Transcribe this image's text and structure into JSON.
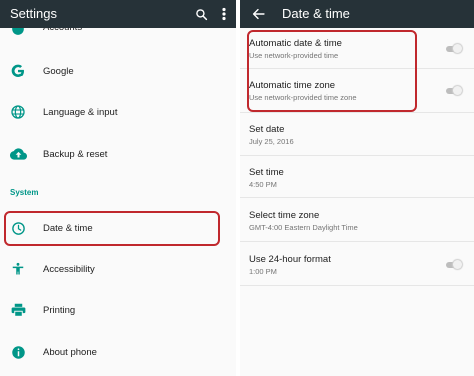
{
  "left": {
    "title": "Settings",
    "partial_item": "Accounts",
    "items": [
      {
        "label": "Google"
      },
      {
        "label": "Language & input"
      },
      {
        "label": "Backup & reset"
      }
    ],
    "section": "System",
    "system_items": [
      {
        "label": "Date & time"
      },
      {
        "label": "Accessibility"
      },
      {
        "label": "Printing"
      },
      {
        "label": "About phone"
      }
    ],
    "icons": {
      "search": "search-icon",
      "overflow": "more-vert-icon"
    }
  },
  "right": {
    "title": "Date & time",
    "settings": [
      {
        "title": "Automatic date & time",
        "summary": "Use network-provided time",
        "toggle": "off"
      },
      {
        "title": "Automatic time zone",
        "summary": "Use network-provided time zone",
        "toggle": "off"
      },
      {
        "title": "Set date",
        "summary": "July 25, 2016"
      },
      {
        "title": "Set time",
        "summary": "4:50 PM"
      },
      {
        "title": "Select time zone",
        "summary": "GMT-4:00 Eastern Daylight Time"
      },
      {
        "title": "Use 24-hour format",
        "summary": "1:00 PM",
        "toggle": "off"
      }
    ]
  },
  "colors": {
    "appbar": "#263238",
    "icon": "#009688",
    "accent": "#009688",
    "highlight": "#c0282d"
  }
}
